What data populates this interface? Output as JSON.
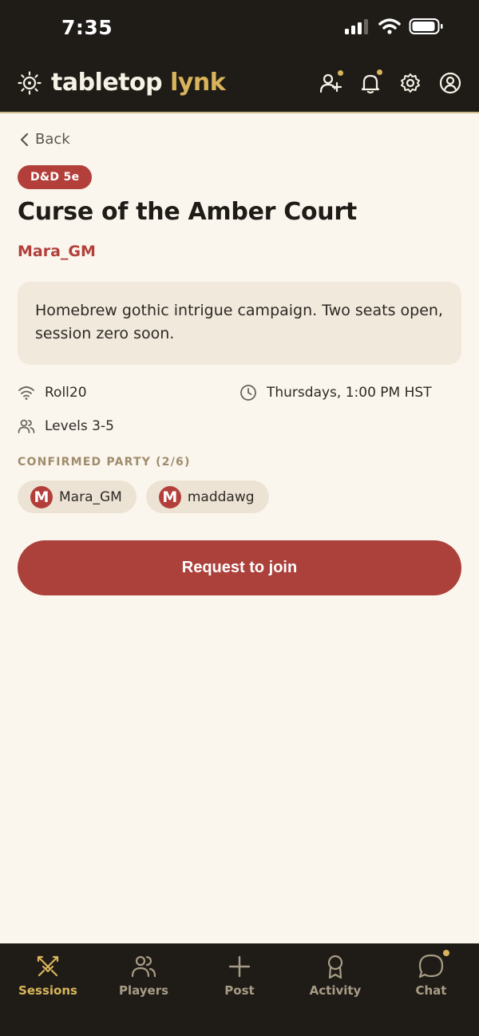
{
  "status": {
    "time": "7:35"
  },
  "app": {
    "brand_a": "tabletop",
    "brand_b": "lynk"
  },
  "back_label": "Back",
  "session": {
    "tag": "D&D 5e",
    "title": "Curse of the Amber Court",
    "gm": "Mara_GM",
    "description": "Homebrew gothic intrigue campaign. Two seats open, session zero soon.",
    "platform": "Roll20",
    "schedule": "Thursdays, 1:00 PM HST",
    "levels": "Levels 3-5"
  },
  "party": {
    "heading": "CONFIRMED PARTY (2/6)",
    "members": [
      {
        "initial": "M",
        "name": "Mara_GM"
      },
      {
        "initial": "M",
        "name": "maddawg"
      }
    ]
  },
  "cta_label": "Request to join",
  "tabs": [
    {
      "label": "Sessions",
      "icon": "swords-icon",
      "active": true
    },
    {
      "label": "Players",
      "icon": "people-icon"
    },
    {
      "label": "Post",
      "icon": "plus-icon"
    },
    {
      "label": "Activity",
      "icon": "badge-icon"
    },
    {
      "label": "Chat",
      "icon": "chat-bubble-icon",
      "badge": true
    }
  ],
  "colors": {
    "accent": "#b33f3a",
    "gold": "#d9b45a",
    "bar": "#1f1c18",
    "background": "#faf6ee"
  }
}
